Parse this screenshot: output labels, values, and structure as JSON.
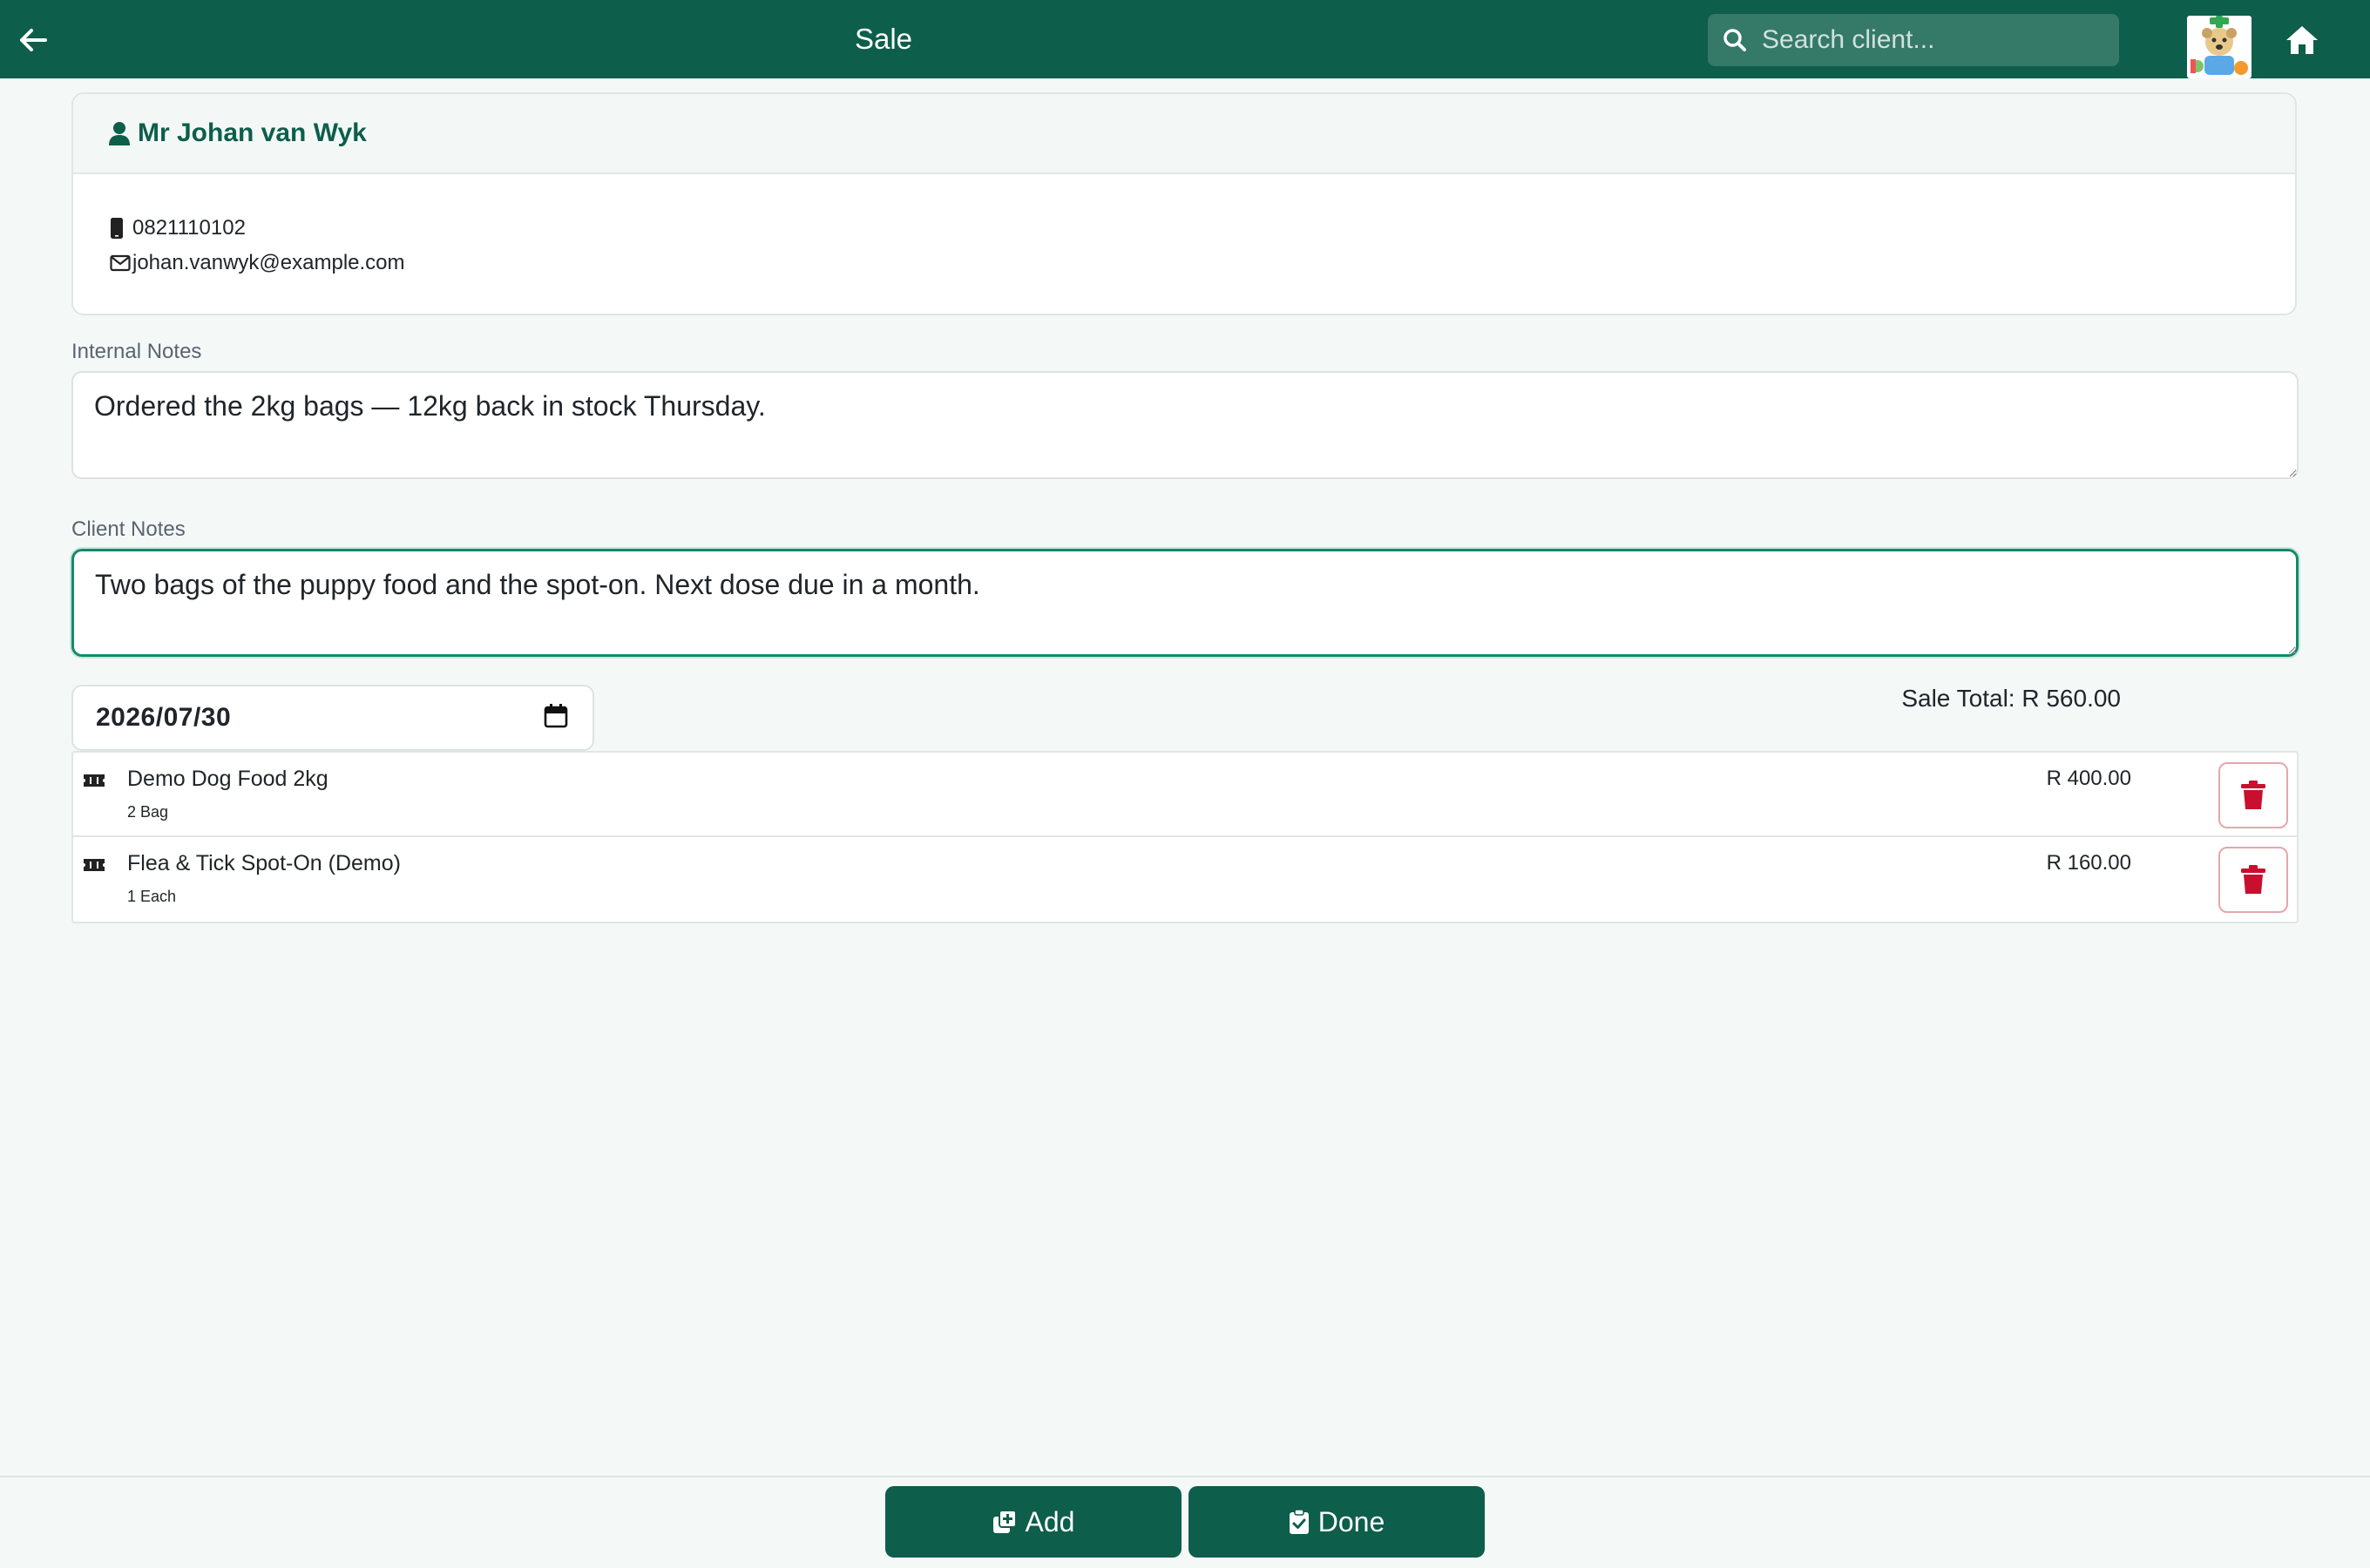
{
  "header": {
    "title": "Sale",
    "search_placeholder": "Search client..."
  },
  "client": {
    "name": "Mr Johan van Wyk",
    "phone": "0821110102",
    "email": "johan.vanwyk@example.com"
  },
  "internal_notes": {
    "label": "Internal Notes",
    "value": "Ordered the 2kg bags — 12kg back in stock Thursday."
  },
  "client_notes": {
    "label": "Client Notes",
    "value": "Two bags of the puppy food and the spot-on. Next dose due in a month."
  },
  "sale": {
    "date": "2026/07/30",
    "total_text": "Sale Total: R 560.00"
  },
  "items": [
    {
      "name": "Demo Dog Food 2kg",
      "quantity": "2 Bag",
      "price": "R 400.00"
    },
    {
      "name": "Flea & Tick Spot-On (Demo)",
      "quantity": "1 Each",
      "price": "R 160.00"
    }
  ],
  "footer": {
    "add_label": "Add",
    "done_label": "Done"
  },
  "colors": {
    "primary": "#0d5e4b",
    "background": "#f4f9f7",
    "danger": "#c8102e",
    "focus_border": "#148a6c"
  }
}
